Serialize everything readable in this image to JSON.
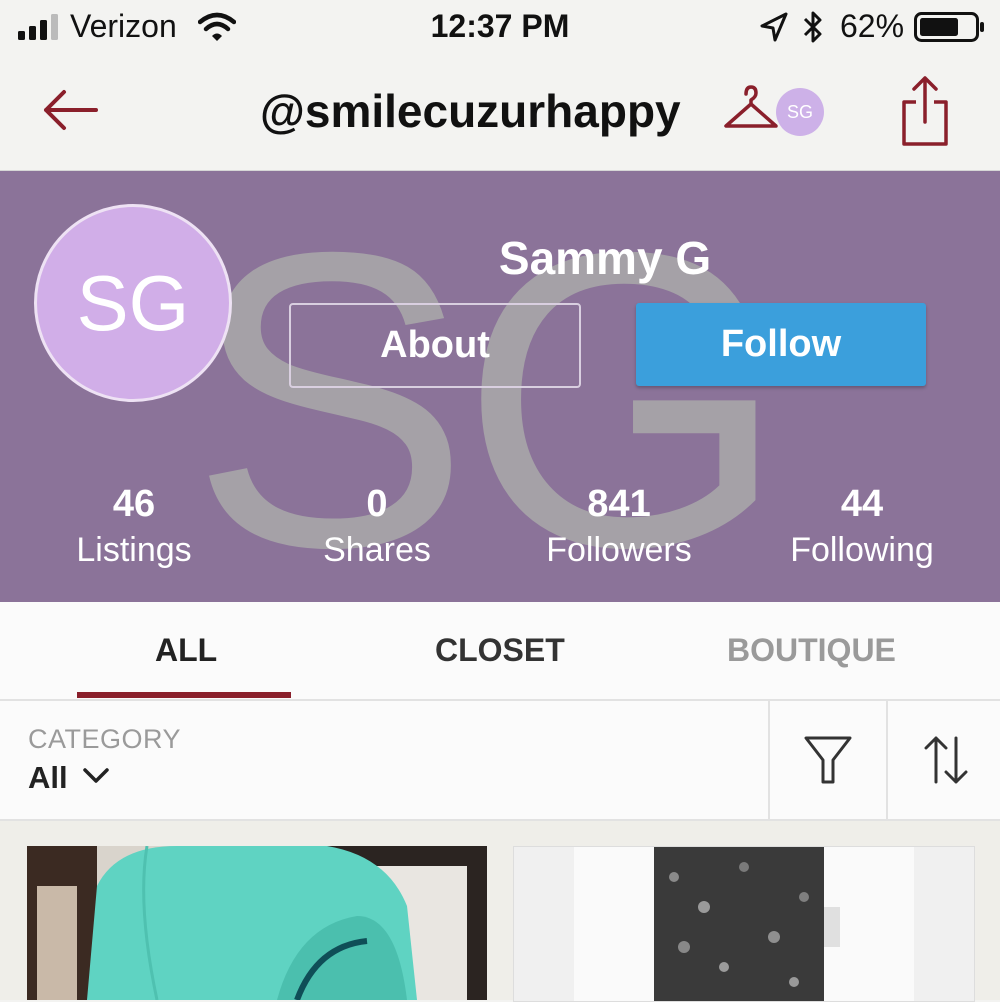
{
  "status_bar": {
    "carrier": "Verizon",
    "time": "12:37 PM",
    "battery": "62%",
    "icons": [
      "signal-icon",
      "wifi-icon",
      "location-icon",
      "bluetooth-icon",
      "battery-icon"
    ]
  },
  "nav": {
    "username": "@smilecuzurhappy",
    "avatar_initials": "SG",
    "icons": [
      "back-arrow-icon",
      "hanger-icon",
      "share-icon"
    ]
  },
  "profile": {
    "watermark": "SG",
    "avatar_initials": "SG",
    "name": "Sammy G",
    "about_label": "About",
    "follow_label": "Follow",
    "stats": [
      {
        "value": "46",
        "label": "Listings"
      },
      {
        "value": "0",
        "label": "Shares"
      },
      {
        "value": "841",
        "label": "Followers"
      },
      {
        "value": "44",
        "label": "Following"
      }
    ]
  },
  "tabs": [
    {
      "label": "ALL",
      "active": true
    },
    {
      "label": "CLOSET",
      "active": false
    },
    {
      "label": "BOUTIQUE",
      "active": false
    }
  ],
  "filter": {
    "category_label": "CATEGORY",
    "category_value": "All",
    "icons": [
      "filter-icon",
      "sort-icon"
    ]
  },
  "colors": {
    "accent": "#8a1f2b",
    "profile_bg": "#8b7399",
    "follow_button": "#3b9fdc",
    "avatar": "#d1aee8"
  }
}
